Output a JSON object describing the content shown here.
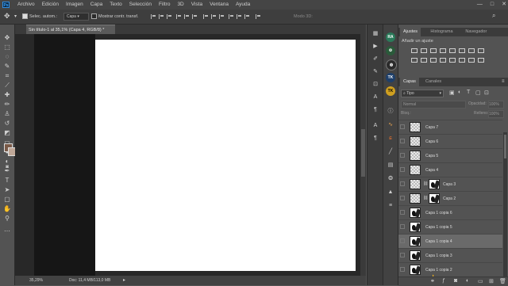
{
  "menu": {
    "logo": "Ps",
    "items": [
      "Archivo",
      "Edición",
      "Imagen",
      "Capa",
      "Texto",
      "Selección",
      "Filtro",
      "3D",
      "Vista",
      "Ventana",
      "Ayuda"
    ],
    "window_controls": [
      "—",
      "□",
      "✕"
    ]
  },
  "options": {
    "auto_select_label": "Selec. autom.:",
    "auto_select_value": "Capa",
    "transform_label": "Mostrar contr. transf.",
    "mode_label": "Modo 3D:"
  },
  "document": {
    "tab_title": "Sin título-1 al 35,1% (Capa 4, RGB/8) *",
    "zoom": "35,29%",
    "doc_size": "Doc: 11,4 MB/113,0 MB"
  },
  "adjust_panel": {
    "tabs": [
      "Ajustes",
      "Histograma",
      "Navegador"
    ],
    "add_label": "Añadir un ajuste"
  },
  "layers_panel": {
    "tabs": [
      "Capas",
      "Canales"
    ],
    "filter_value": "Tipo",
    "blend_mode": "Normal",
    "opacity_label": "Opacidad:",
    "opacity_value": "100%",
    "lock_label": "Bloq.:",
    "fill_label": "Relleno:",
    "fill_value": "100%",
    "layers": [
      {
        "name": "Capa 7",
        "type": "transparent",
        "selected": false
      },
      {
        "name": "Capa 6",
        "type": "transparent",
        "selected": false
      },
      {
        "name": "Capa 5",
        "type": "transparent",
        "selected": false
      },
      {
        "name": "Capa 4",
        "type": "transparent",
        "selected": false
      },
      {
        "name": "Capa 3",
        "type": "mask",
        "selected": false
      },
      {
        "name": "Capa 2",
        "type": "mask",
        "selected": false
      },
      {
        "name": "Capa 1 copia 6",
        "type": "image",
        "selected": false
      },
      {
        "name": "Capa 1 copia 5",
        "type": "image",
        "selected": false
      },
      {
        "name": "Capa 1 copia 4",
        "type": "image",
        "selected": true
      },
      {
        "name": "Capa 1 copia 3",
        "type": "image",
        "selected": false
      },
      {
        "name": "Capa 1 copia 2",
        "type": "image",
        "selected": false
      }
    ]
  },
  "colors": {
    "foreground": "#7a5a48",
    "background": "#c0a898"
  }
}
